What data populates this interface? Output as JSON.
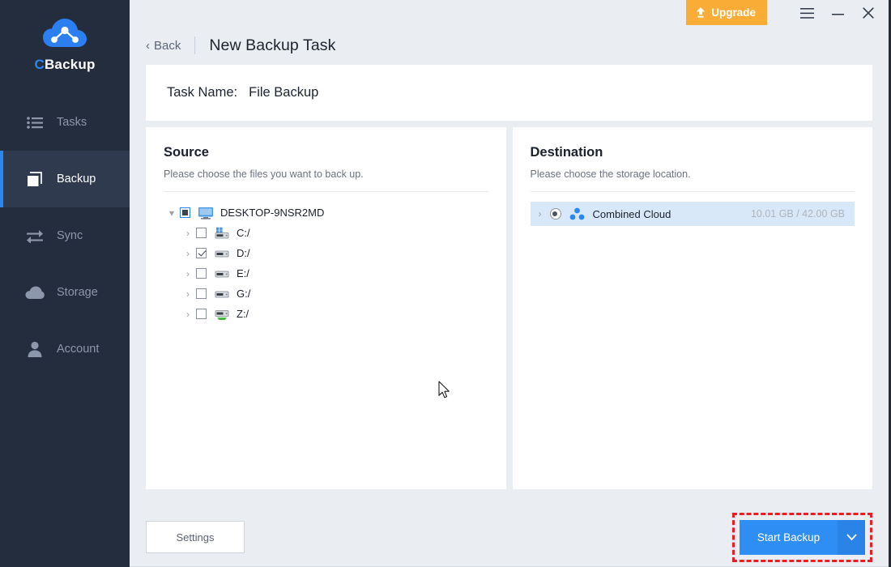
{
  "app": {
    "brand_name_prefix": "C",
    "brand_name_rest": "Backup",
    "accent_blue": "#2b87f0",
    "sidebar_bg": "#242d3e",
    "upgrade_orange": "#f9ad36",
    "highlight_red": "#ed1c24"
  },
  "sidebar": {
    "items": [
      {
        "label": "Tasks",
        "icon": "list-icon",
        "active": false
      },
      {
        "label": "Backup",
        "icon": "copy-icon",
        "active": true
      },
      {
        "label": "Sync",
        "icon": "sync-arrows-icon",
        "active": false
      },
      {
        "label": "Storage",
        "icon": "cloud-icon",
        "active": false
      },
      {
        "label": "Account",
        "icon": "user-icon",
        "active": false
      }
    ]
  },
  "titlebar": {
    "upgrade_label": "Upgrade",
    "upgrade_icon": "upload-arrow-icon",
    "menu_icon": "hamburger-menu-icon",
    "minimize_icon": "minimize-icon",
    "close_icon": "close-icon"
  },
  "header": {
    "back_label": "Back",
    "back_icon": "chevron-left-icon",
    "title": "New Backup Task"
  },
  "task": {
    "name_label": "Task Name:",
    "name_value": "File Backup"
  },
  "source": {
    "title": "Source",
    "hint": "Please choose the files you want to back up.",
    "root": {
      "label": "DESKTOP-9NSR2MD",
      "icon": "computer-icon",
      "expander": "chevron-down-icon",
      "checkbox_state": "partial"
    },
    "drives": [
      {
        "label": "C:/",
        "icon": "windows-drive-icon",
        "checkbox_state": "unchecked",
        "expander": "chevron-right-icon"
      },
      {
        "label": "D:/",
        "icon": "drive-icon",
        "checkbox_state": "checked",
        "expander": "chevron-right-icon"
      },
      {
        "label": "E:/",
        "icon": "drive-icon",
        "checkbox_state": "unchecked",
        "expander": "chevron-right-icon"
      },
      {
        "label": "G:/",
        "icon": "drive-icon",
        "checkbox_state": "unchecked",
        "expander": "chevron-right-icon"
      },
      {
        "label": "Z:/",
        "icon": "network-drive-icon",
        "checkbox_state": "unchecked",
        "expander": "chevron-right-icon"
      }
    ]
  },
  "destination": {
    "title": "Destination",
    "hint": "Please choose the storage location.",
    "items": [
      {
        "label": "Combined Cloud",
        "size": "10.01 GB / 42.00 GB",
        "icon": "combined-cloud-icon",
        "expander": "chevron-right-icon",
        "selected": true
      }
    ]
  },
  "footer": {
    "settings_label": "Settings",
    "start_label": "Start Backup",
    "start_caret_icon": "chevron-down-icon"
  }
}
